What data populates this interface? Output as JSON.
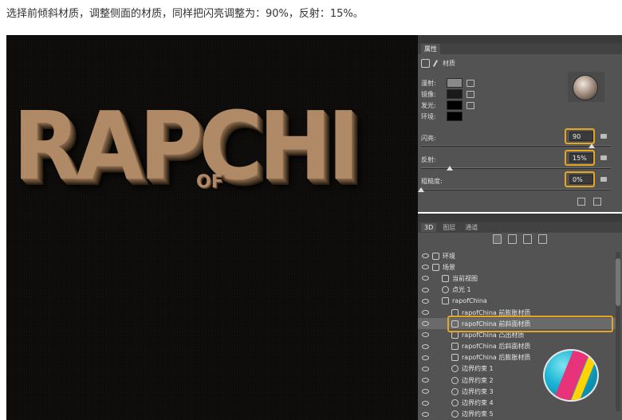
{
  "caption": "选择前倾斜材质，调整侧面的材质，同样把闪亮调整为：90%，反射：15%。",
  "canvas": {
    "headline": "RAPCHI",
    "small": "OF"
  },
  "properties": {
    "tab": "属性",
    "mode_label": "材质",
    "diffuse": "漫射:",
    "specular": "镜像:",
    "glow": "发光:",
    "ambient": "环境:",
    "shine_label": "闪亮:",
    "shine_value": "90",
    "shine_level": 0.9,
    "reflection_label": "反射:",
    "reflection_value": "15%",
    "reflection_level": 0.15,
    "roughness_label": "粗糙度:",
    "roughness_value": "0%",
    "roughness_level": 0.0
  },
  "layers_panel": {
    "tabs": [
      "3D",
      "图层",
      "通道"
    ],
    "items": [
      {
        "label": "环境",
        "icon": "environment-icon",
        "indent": 0
      },
      {
        "label": "场景",
        "icon": "scene-icon",
        "indent": 0
      },
      {
        "label": "当前视图",
        "icon": "camera-icon",
        "indent": 1
      },
      {
        "label": "点光 1",
        "icon": "light-icon",
        "indent": 1
      },
      {
        "label": "rapofChina",
        "icon": "mesh-icon",
        "indent": 1
      },
      {
        "label": "rapofChina 前膨胀材质",
        "icon": "material-icon",
        "indent": 2
      },
      {
        "label": "rapofChina 前斜面材质",
        "icon": "material-icon",
        "indent": 2,
        "selected": true
      },
      {
        "label": "rapofChina 凸出材质",
        "icon": "material-icon",
        "indent": 2
      },
      {
        "label": "rapofChina 后斜面材质",
        "icon": "material-icon",
        "indent": 2
      },
      {
        "label": "rapofChina 后膨胀材质",
        "icon": "material-icon",
        "indent": 2
      },
      {
        "label": "边界约束 1",
        "icon": "constraint-icon",
        "indent": 2
      },
      {
        "label": "边界约束 2",
        "icon": "constraint-icon",
        "indent": 2
      },
      {
        "label": "边界约束 3",
        "icon": "constraint-icon",
        "indent": 2
      },
      {
        "label": "边界约束 4",
        "icon": "constraint-icon",
        "indent": 2
      },
      {
        "label": "边界约束 5",
        "icon": "constraint-icon",
        "indent": 2
      }
    ]
  },
  "colors": {
    "highlight": "#e5a623",
    "panel": "#535353",
    "canvas": "#0d0c0b"
  }
}
